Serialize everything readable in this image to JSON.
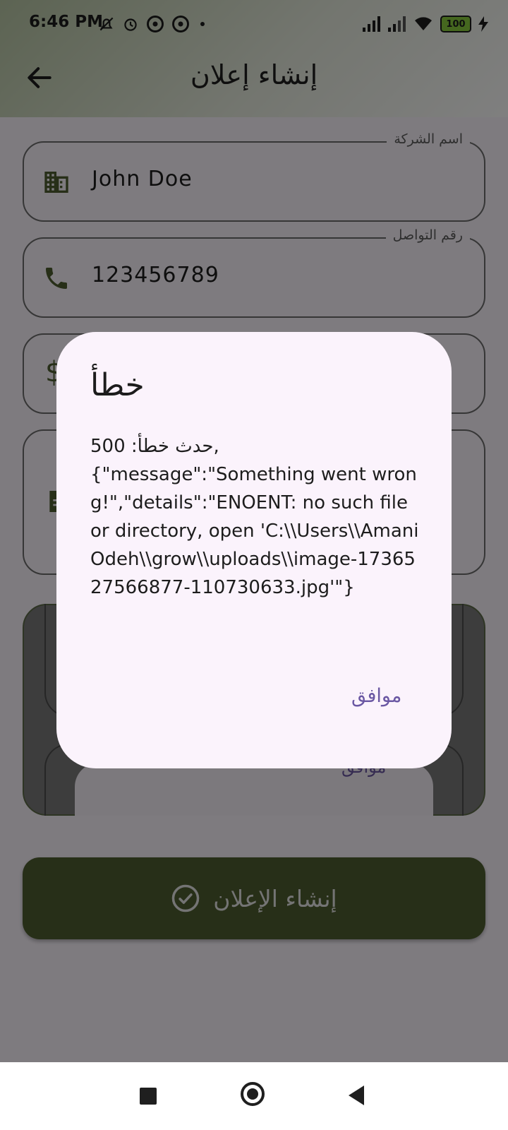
{
  "status_bar": {
    "time": "6:46 PM",
    "battery": "100",
    "left_icons": [
      "muted-bell-icon",
      "alarm-icon",
      "vpn-icon",
      "vpn-icon",
      "dot-icon"
    ],
    "right_icons": [
      "signal-icon",
      "signal-icon",
      "wifi-icon",
      "battery-icon",
      "charging-icon"
    ]
  },
  "app_bar": {
    "title": "إنشاء إعلان",
    "back_icon": "arrow-left-icon"
  },
  "form": {
    "company": {
      "label": "اسم الشركة",
      "value": "John Doe",
      "icon": "building-icon"
    },
    "contact": {
      "label": "رقم التواصل",
      "value": "123456789",
      "icon": "phone-icon"
    },
    "inner_dialog_ok": "موافق"
  },
  "submit_button": {
    "label": "إنشاء الإعلان",
    "icon": "check-circle-icon"
  },
  "dialog": {
    "title": "خطأ",
    "message": "حدث خطأ: 500,\n{\"message\":\"Something went wrong!\",\"details\":\"ENOENT: no such file or directory, open 'C:\\\\Users\\\\Amani Odeh\\\\grow\\\\uploads\\\\image-1736527566877-110730633.jpg'\"}",
    "ok_label": "موافق"
  },
  "colors": {
    "accent": "#4e5e30",
    "dialog_bg": "#fbf3fc",
    "action_text": "#6a57a3"
  }
}
